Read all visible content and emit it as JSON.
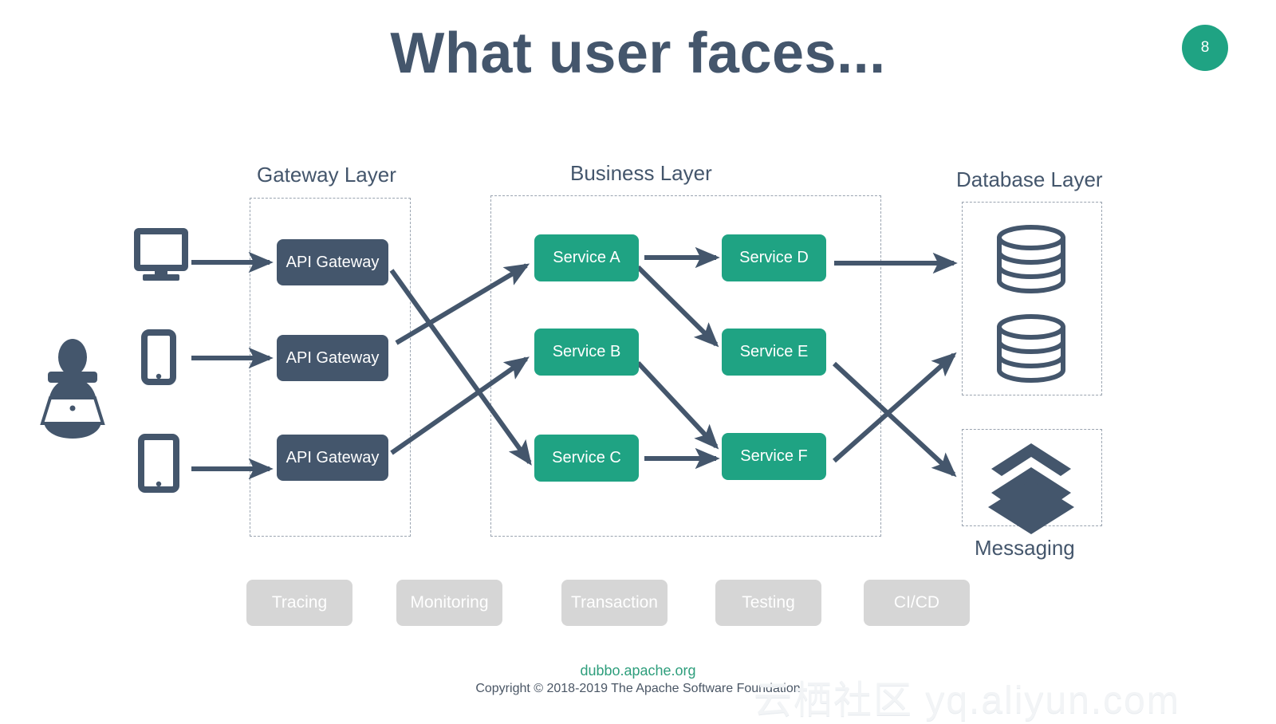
{
  "slide": {
    "title": "What user faces...",
    "page_number": "8",
    "accent_green": "#1fa383",
    "dark_slate": "#44566c",
    "pill_gray": "#d6d6d6",
    "background": "#ffffff"
  },
  "diagram": {
    "layers": [
      {
        "id": "gateway",
        "label": "Gateway Layer"
      },
      {
        "id": "business",
        "label": "Business Layer"
      },
      {
        "id": "database",
        "label": "Database Layer"
      },
      {
        "id": "messaging",
        "label": "Messaging"
      }
    ],
    "clients": [
      {
        "id": "desktop",
        "icon": "desktop-monitor-icon"
      },
      {
        "id": "phone",
        "icon": "mobile-phone-icon"
      },
      {
        "id": "tablet",
        "icon": "tablet-icon"
      }
    ],
    "user_icon": "user-with-laptop-icon",
    "gateways": [
      {
        "id": "gw-1",
        "label": "API Gateway"
      },
      {
        "id": "gw-2",
        "label": "API Gateway"
      },
      {
        "id": "gw-3",
        "label": "API Gateway"
      }
    ],
    "services": [
      {
        "id": "svc-a",
        "label": "Service A"
      },
      {
        "id": "svc-b",
        "label": "Service B"
      },
      {
        "id": "svc-c",
        "label": "Service C"
      },
      {
        "id": "svc-d",
        "label": "Service D"
      },
      {
        "id": "svc-e",
        "label": "Service E"
      },
      {
        "id": "svc-f",
        "label": "Service F"
      }
    ],
    "databases": [
      {
        "id": "db-1",
        "icon": "database-cylinder-icon"
      },
      {
        "id": "db-2",
        "icon": "database-cylinder-icon"
      }
    ],
    "messaging_icon": "stacked-layers-icon",
    "connections": [
      {
        "from": "desktop",
        "to": "gw-1"
      },
      {
        "from": "phone",
        "to": "gw-2"
      },
      {
        "from": "tablet",
        "to": "gw-3"
      },
      {
        "from": "gw-1",
        "to": "svc-c"
      },
      {
        "from": "gw-2",
        "to": "svc-a"
      },
      {
        "from": "gw-3",
        "to": "svc-b"
      },
      {
        "from": "svc-a",
        "to": "svc-d"
      },
      {
        "from": "svc-a",
        "to": "svc-e"
      },
      {
        "from": "svc-b",
        "to": "svc-f"
      },
      {
        "from": "svc-c",
        "to": "svc-f"
      },
      {
        "from": "svc-d",
        "to": "db-1"
      },
      {
        "from": "svc-e",
        "to": "messaging"
      },
      {
        "from": "svc-f",
        "to": "db-2"
      }
    ]
  },
  "capability_pills": [
    {
      "id": "tracing",
      "label": "Tracing"
    },
    {
      "id": "monitoring",
      "label": "Monitoring"
    },
    {
      "id": "transaction",
      "label": "Transaction"
    },
    {
      "id": "testing",
      "label": "Testing"
    },
    {
      "id": "cicd",
      "label": "CI/CD"
    }
  ],
  "footer": {
    "link": "dubbo.apache.org",
    "copyright": "Copyright © 2018-2019 The Apache Software Foundation"
  },
  "watermark": {
    "text": "云栖社区 yq.aliyun.com"
  }
}
